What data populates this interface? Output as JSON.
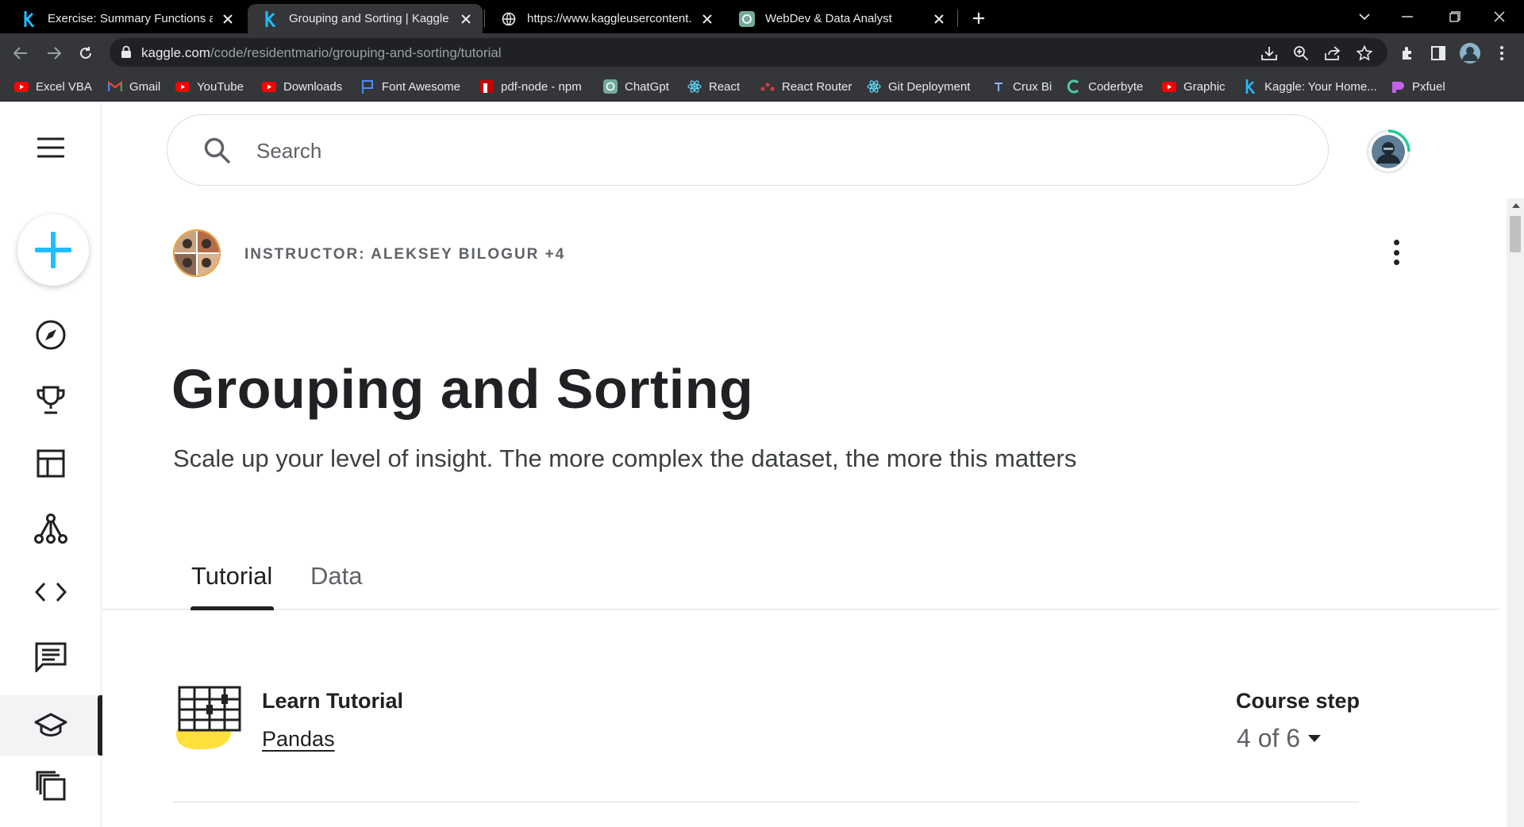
{
  "browser": {
    "tabs": [
      {
        "title": "Exercise: Summary Functions and",
        "icon": "kaggle-k-icon",
        "active": false
      },
      {
        "title": "Grouping and Sorting | Kaggle",
        "icon": "kaggle-k-icon",
        "active": true
      },
      {
        "title": "https://www.kaggleusercontent.c",
        "icon": "globe-icon",
        "active": false
      },
      {
        "title": "WebDev & Data Analyst",
        "icon": "chatgpt-icon",
        "active": false
      }
    ],
    "url_host": "kaggle.com",
    "url_path": "/code/residentmario/grouping-and-sorting/tutorial",
    "bookmarks": [
      {
        "label": "Excel VBA",
        "icon": "youtube-icon"
      },
      {
        "label": "Gmail",
        "icon": "gmail-icon"
      },
      {
        "label": "YouTube",
        "icon": "youtube-icon"
      },
      {
        "label": "Downloads",
        "icon": "youtube-icon"
      },
      {
        "label": "Font Awesome",
        "icon": "flag-icon"
      },
      {
        "label": "pdf-node - npm",
        "icon": "npm-icon"
      },
      {
        "label": "ChatGpt",
        "icon": "chatgpt-icon"
      },
      {
        "label": "React",
        "icon": "react-icon"
      },
      {
        "label": "React Router",
        "icon": "react-router-icon"
      },
      {
        "label": "Git Deployment",
        "icon": "react-icon"
      },
      {
        "label": "Crux Bi",
        "icon": "crux-icon"
      },
      {
        "label": "Coderbyte",
        "icon": "coderbyte-icon"
      },
      {
        "label": "Graphic",
        "icon": "youtube-icon"
      },
      {
        "label": "Kaggle: Your Home...",
        "icon": "kaggle-k-icon"
      },
      {
        "label": "Pxfuel",
        "icon": "pxfuel-icon"
      }
    ],
    "colors": {
      "tabstrip": "#000000",
      "toolbar": "#35363a",
      "omnibox": "#202124",
      "youtube": "#ff0000"
    }
  },
  "search": {
    "placeholder": "Search"
  },
  "header": {
    "instructor": "INSTRUCTOR: ALEKSEY BILOGUR +4",
    "title": "Grouping and Sorting",
    "subtitle": "Scale up your level of insight. The more complex the dataset, the more this matters"
  },
  "tabs": [
    {
      "label": "Tutorial",
      "active": true
    },
    {
      "label": "Data",
      "active": false
    }
  ],
  "course": {
    "label": "Learn Tutorial",
    "name": "Pandas",
    "step_label": "Course step",
    "step_value": "4 of 6"
  },
  "sidebar": {
    "items": [
      "compass-icon",
      "trophy-icon",
      "table-icon",
      "models-icon",
      "code-icon",
      "discussion-icon",
      "learn-icon",
      "more-icon"
    ],
    "active": "learn-icon"
  },
  "colors": {
    "kaggle_blue": "#20beff",
    "text": "#202124",
    "muted": "#5f6368",
    "accent_yellow": "#ffe03d"
  }
}
